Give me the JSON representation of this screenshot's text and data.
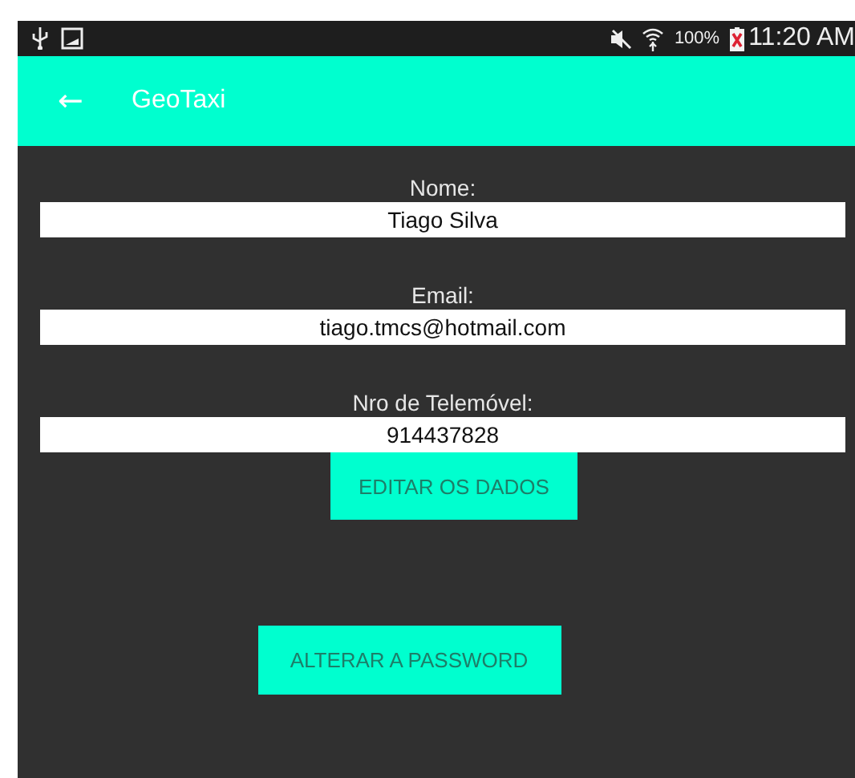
{
  "status_bar": {
    "battery": "100%",
    "time": "11:20 AM"
  },
  "app_bar": {
    "back": "←",
    "title": "GeoTaxi"
  },
  "fields": [
    {
      "label": "Nome:",
      "value": "Tiago Silva"
    },
    {
      "label": "Email:",
      "value": "tiago.tmcs@hotmail.com"
    },
    {
      "label": "Nro de Telemóvel:",
      "value": "914437828"
    }
  ],
  "buttons": [
    {
      "label": "EDITAR OS DADOS",
      "kind": "edit"
    },
    {
      "label": "ALTERAR A PASSWORD",
      "kind": "password"
    }
  ]
}
